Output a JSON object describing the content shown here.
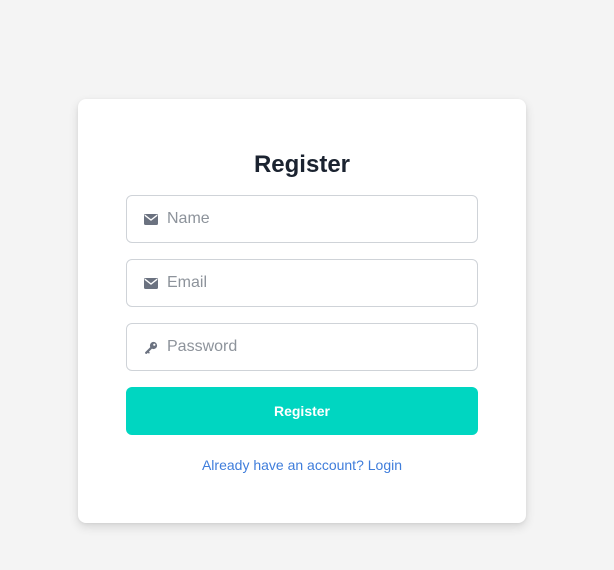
{
  "form": {
    "title": "Register",
    "name_placeholder": "Name",
    "email_placeholder": "Email",
    "password_placeholder": "Password",
    "submit_label": "Register",
    "login_link_text": "Already have an account? Login"
  },
  "icons": {
    "name_field": "envelope-icon",
    "email_field": "envelope-icon",
    "password_field": "key-icon"
  },
  "colors": {
    "button": "#00d6c1",
    "link": "#3f7ddb",
    "title": "#1b2330",
    "background": "#f4f4f4"
  }
}
